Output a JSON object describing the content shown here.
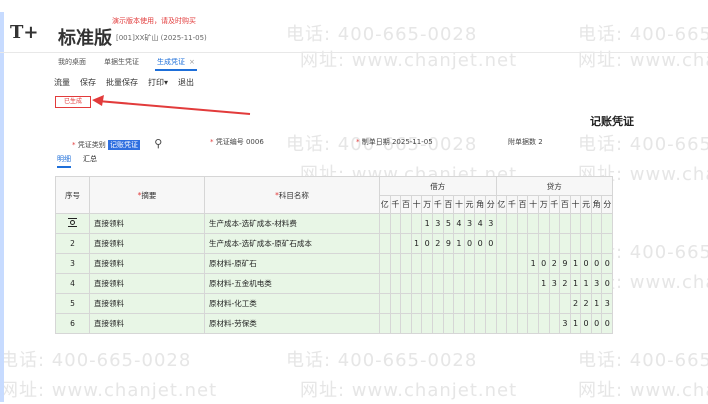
{
  "app": {
    "logo_symbol": "T+",
    "brand": "标准版",
    "demo_notice": "演示版本使用，请及时购买",
    "company": "[001]XX矿山    (2025-11-05)"
  },
  "watermark": {
    "phone": "电话: 400-665-0028",
    "site": "网址: www.chanjet.net",
    "site_short": "网址: www.cha",
    "phone_short": "电话: 400-665"
  },
  "tabs": [
    {
      "label": "我的桌面"
    },
    {
      "label": "单据生凭证"
    },
    {
      "label": "生成凭证",
      "close": "×"
    }
  ],
  "toolbar": {
    "items": [
      "流量",
      "保存",
      "批量保存",
      "打印▾",
      "退出"
    ]
  },
  "status_stamp": "已生成",
  "voucher": {
    "title": "记账凭证",
    "type_label": "凭证类别",
    "type_value": "记账凭证",
    "number_label": "凭证编号",
    "number_value": "0006",
    "date_label": "制单日期",
    "date_value": "2025-11-05",
    "attach_label": "附单据数",
    "attach_value": "2"
  },
  "subtabs": [
    "明细",
    "汇总"
  ],
  "table": {
    "headers": {
      "seq": "序号",
      "summary": "摘要",
      "account": "科目名称",
      "debit": "借方",
      "credit": "贷方"
    },
    "digit_headers": [
      "亿",
      "千",
      "百",
      "十",
      "万",
      "千",
      "百",
      "十",
      "元",
      "角",
      "分"
    ],
    "rows": [
      {
        "seq": "",
        "summary": "直接领料",
        "account": "生产成本-选矿成本-材料费",
        "debit": [
          "",
          "",
          "",
          "",
          "1",
          "3",
          "5",
          "4",
          "3",
          "4",
          "3"
        ],
        "credit": [
          "",
          "",
          "",
          "",
          "",
          "",
          "",
          "",
          "",
          "",
          ""
        ]
      },
      {
        "seq": "2",
        "summary": "直接领料",
        "account": "生产成本-选矿成本-原矿石成本",
        "debit": [
          "",
          "",
          "",
          "1",
          "0",
          "2",
          "9",
          "1",
          "0",
          "0",
          "0"
        ],
        "credit": [
          "",
          "",
          "",
          "",
          "",
          "",
          "",
          "",
          "",
          "",
          ""
        ]
      },
      {
        "seq": "3",
        "summary": "直接领料",
        "account": "原材料-原矿石",
        "debit": [
          "",
          "",
          "",
          "",
          "",
          "",
          "",
          "",
          "",
          "",
          ""
        ],
        "credit": [
          "",
          "",
          "",
          "1",
          "0",
          "2",
          "9",
          "1",
          "0",
          "0",
          "0"
        ]
      },
      {
        "seq": "4",
        "summary": "直接领料",
        "account": "原材料-五金机电类",
        "debit": [
          "",
          "",
          "",
          "",
          "",
          "",
          "",
          "",
          "",
          "",
          ""
        ],
        "credit": [
          "",
          "",
          "",
          "",
          "1",
          "3",
          "2",
          "1",
          "1",
          "3",
          "0"
        ]
      },
      {
        "seq": "5",
        "summary": "直接领料",
        "account": "原材料-化工类",
        "debit": [
          "",
          "",
          "",
          "",
          "",
          "",
          "",
          "",
          "",
          "",
          ""
        ],
        "credit": [
          "",
          "",
          "",
          "",
          "",
          "",
          "",
          "2",
          "2",
          "1",
          "3"
        ]
      },
      {
        "seq": "6",
        "summary": "直接领料",
        "account": "原材料-劳保类",
        "debit": [
          "",
          "",
          "",
          "",
          "",
          "",
          "",
          "",
          "",
          "",
          ""
        ],
        "credit": [
          "",
          "",
          "",
          "",
          "",
          "",
          "3",
          "1",
          "0",
          "0",
          "0"
        ]
      }
    ]
  }
}
